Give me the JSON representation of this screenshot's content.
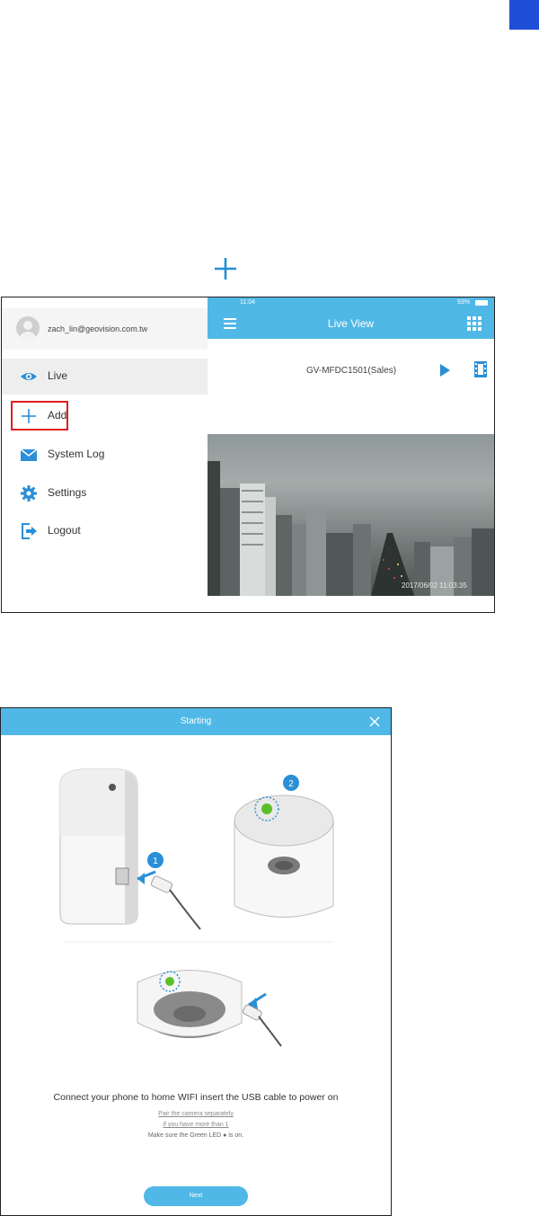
{
  "shot1": {
    "drawer": {
      "user_email": "zach_lin@geovision.com.tw",
      "items": [
        {
          "label": "Live",
          "icon": "eye-icon"
        },
        {
          "label": "Add",
          "icon": "plus-icon"
        },
        {
          "label": "System Log",
          "icon": "envelope-icon"
        },
        {
          "label": "Settings",
          "icon": "gear-icon"
        },
        {
          "label": "Logout",
          "icon": "logout-icon"
        }
      ]
    },
    "liveview": {
      "status_time": "11:04",
      "status_battery": "93%",
      "title": "Live View",
      "camera_name": "GV-MFDC1501(Sales)",
      "timestamp": "2017/06/02   11:03:35"
    }
  },
  "shot2": {
    "title": "Starting",
    "main_text": "Connect your phone to home WIFI insert the USB cable to power on",
    "link1": "Pair the camera separately",
    "link2": "if you have more than 1",
    "note": "Make sure the Green LED ● is on.",
    "next_button": "Next"
  },
  "colors": {
    "accent": "#50b8e6",
    "highlight": "#e02020",
    "tab": "#1f4fd8"
  }
}
